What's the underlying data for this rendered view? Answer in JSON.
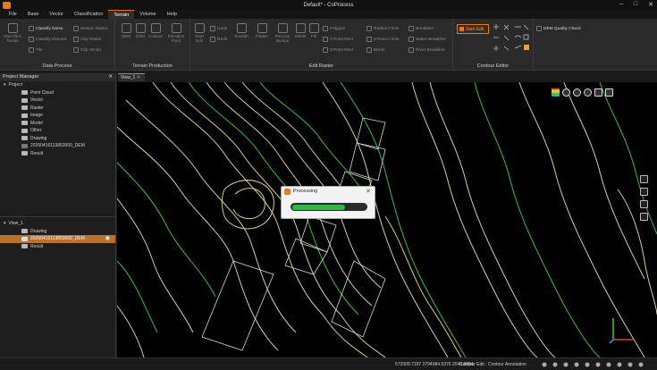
{
  "window": {
    "title": "Default* - CoProcess"
  },
  "menus": [
    "File",
    "Base",
    "Vector",
    "Classification",
    "Terrain",
    "Volume",
    "Help"
  ],
  "active_menu": "Terrain",
  "ribbon": {
    "data_process": {
      "label": "Data Process",
      "one_click": "One-Click Terrain",
      "tile": "Tile",
      "classify_noise": "Classify Noise",
      "classify_ground": "Classify Ground",
      "mosaic_raster": "Mosaic Raster",
      "clip_raster": "Clip Raster",
      "clip_vector": "Clip Vector"
    },
    "terrain_production": {
      "label": "Terrain Production",
      "dem": "DEM",
      "dsm": "DSM",
      "contour": "Contour",
      "elevation_point": "Elevation Point"
    },
    "edit_raster": {
      "label": "Edit Raster",
      "start_edit": "Start Edit",
      "undo": "Undo",
      "redo": "Redo",
      "smooth": "Smooth",
      "flatten": "Flatten",
      "remove_bumps": "Remove Bumps",
      "delete": "Delete",
      "fill": "Fill",
      "polygon": "Polygon",
      "two_point_rect": "2 Point Rect",
      "three_point_rect": "3 Point Rect",
      "radius_circle": "Radius Circle",
      "three_point_circle": "3 Point Circle",
      "brush": "Brush",
      "breakline": "Breakline",
      "water_breakline": "Water Breakline",
      "river_breakline": "River Breakline"
    },
    "contour_editor": {
      "label": "Contour Editor",
      "start_edit": "Start Edit",
      "dem_quality_check": "DEM Quality Check"
    }
  },
  "project_manager": {
    "title": "Project Manager",
    "root": "Project",
    "items": [
      "Point Cloud",
      "Vector",
      "Raster",
      "Image",
      "Model",
      "Other",
      "Drawing",
      "20260416113853000_DEM",
      "Result"
    ]
  },
  "view_panel": {
    "root": "View_1",
    "items": [
      "Drawing",
      "20260416113853000_DEM",
      "Result"
    ],
    "selected": "20260416113853000_DEM"
  },
  "view_tab": "View_1",
  "dialog": {
    "title": "Processing",
    "progress": 0.72,
    "progress_color": "#22c23a"
  },
  "status": {
    "coords": "572009.7197 2794084.5376 2048.8684",
    "mode": "Contour Edit : Contour Annotation"
  },
  "colors": {
    "accent": "#e8771e",
    "contour_green": "#3dbb3d",
    "contour_yellow": "#d7d184"
  },
  "icons": [
    "logo-icon",
    "minimize-icon",
    "maximize-icon",
    "close-icon",
    "folder-icon",
    "eye-icon",
    "axis-icon"
  ]
}
